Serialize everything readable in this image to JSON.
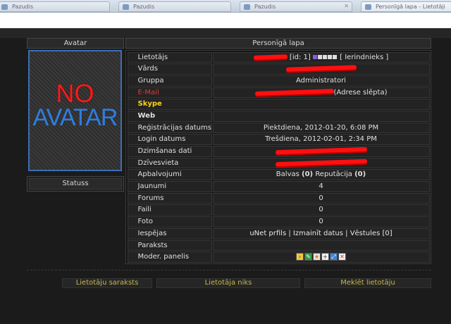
{
  "browser": {
    "tabs": [
      {
        "label": "Pazudis"
      },
      {
        "label": "Pazudis"
      },
      {
        "label": "Pazudis"
      },
      {
        "label": "Personīgā lapa - Lietotāji"
      }
    ]
  },
  "sidebar": {
    "header": "Avatar",
    "avatar_line1": "NO",
    "avatar_line2": "AVATAR",
    "status_label": "Statuss"
  },
  "main": {
    "header": "Personīgā lapa",
    "rows": [
      {
        "label": "Lietotājs",
        "value_id": "[id: 1]",
        "value_group": "[ Ierindnieks ]"
      },
      {
        "label": "Vārds"
      },
      {
        "label": "Gruppa",
        "value": "Administratori"
      },
      {
        "label": "E-Mail",
        "value": "(Adrese slēpta)"
      },
      {
        "label": "Skype",
        "value": ""
      },
      {
        "label": "Web",
        "value": ""
      },
      {
        "label": "Reģistrācijas datums",
        "value": "Piektdiena, 2012-01-20, 6:08 PM"
      },
      {
        "label": "Login datums",
        "value": "Trešdiena, 2012-02-01, 2:34 PM"
      },
      {
        "label": "Dzimšanas dati"
      },
      {
        "label": "Dzīvesvieta"
      },
      {
        "label": "Apbalvojumi",
        "value_a": "Balvas",
        "value_a_count": "(0)",
        "value_b": "Reputācija",
        "value_b_count": "(0)"
      },
      {
        "label": "Jaunumi",
        "value": "4"
      },
      {
        "label": "Forums",
        "value": "0"
      },
      {
        "label": "Faili",
        "value": "0"
      },
      {
        "label": "Foto",
        "value": "0"
      },
      {
        "label": "Iespējas",
        "link1": "uNet prfils",
        "sep": "|",
        "link2": "Izmainīt datus",
        "link3": "Vēstules [0]"
      },
      {
        "label": "Paraksts",
        "value": ""
      },
      {
        "label": "Moder. panelis"
      }
    ]
  },
  "footer": {
    "users_list": "Lietotāju saraksts",
    "user_nick": "Lietotāja niks",
    "search_user": "Meklēt lietotāju"
  },
  "colors": {
    "email_label": "#e03a3a",
    "skype_label": "#ffd21a",
    "footer_link": "#c7b74a",
    "avatar_border": "#3b6fb6",
    "redaction": "#ff1010"
  }
}
